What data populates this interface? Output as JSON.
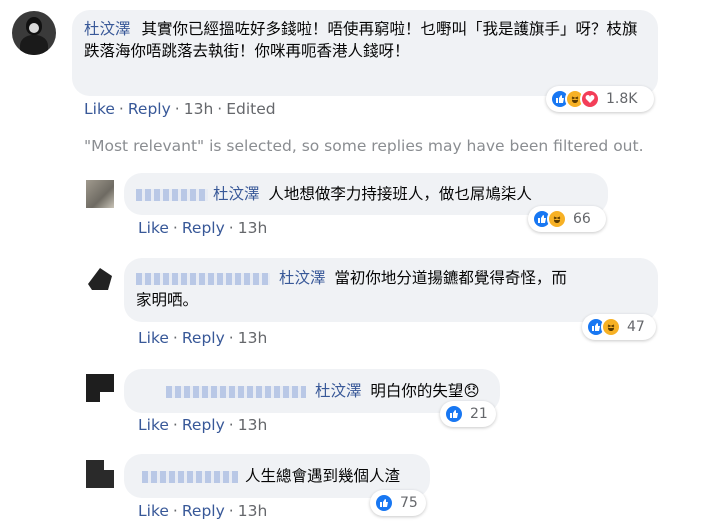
{
  "main_comment": {
    "author": "杜汶澤",
    "text": "其實你已經搵咗好多錢啦！唔使再窮啦！乜嘢叫「我是護旗手」呀？枝旗跌落海你唔跳落去執街！你咪再呃香港人錢呀！",
    "actions": {
      "like": "Like",
      "reply": "Reply",
      "time": "13h",
      "edited": "Edited"
    },
    "reaction_count": "1.8K",
    "reactions": [
      "like-icon",
      "haha-icon",
      "love-icon"
    ]
  },
  "filter_note": "\"Most relevant\" is selected, so some replies may have been filtered out.",
  "replies": [
    {
      "mention": "杜汶澤",
      "text": "人地想做李力持接班人，做乜屌鳩柒人",
      "actions": {
        "like": "Like",
        "reply": "Reply",
        "time": "13h"
      },
      "reaction_count": "66",
      "reactions": [
        "like-icon",
        "haha-icon"
      ]
    },
    {
      "mention": "杜汶澤",
      "text_line1": "當初你地分道揚鑣都覺得奇怪，而",
      "text_line2": "家明哂。",
      "actions": {
        "like": "Like",
        "reply": "Reply",
        "time": "13h"
      },
      "reaction_count": "47",
      "reactions": [
        "like-icon",
        "haha-icon"
      ]
    },
    {
      "mention": "杜汶澤",
      "text": "明白你的失望😞",
      "actions": {
        "like": "Like",
        "reply": "Reply",
        "time": "13h"
      },
      "reaction_count": "21",
      "reactions": [
        "like-icon"
      ]
    },
    {
      "mention": "",
      "text": "人生總會遇到幾個人渣",
      "actions": {
        "like": "Like",
        "reply": "Reply",
        "time": "13h"
      },
      "reaction_count": "75",
      "reactions": [
        "like-icon"
      ]
    }
  ],
  "colors": {
    "link": "#385898",
    "muted": "#65676b",
    "bubble": "#f0f2f5",
    "like": "#1877f2",
    "haha": "#f7b125",
    "love": "#f33e58"
  }
}
